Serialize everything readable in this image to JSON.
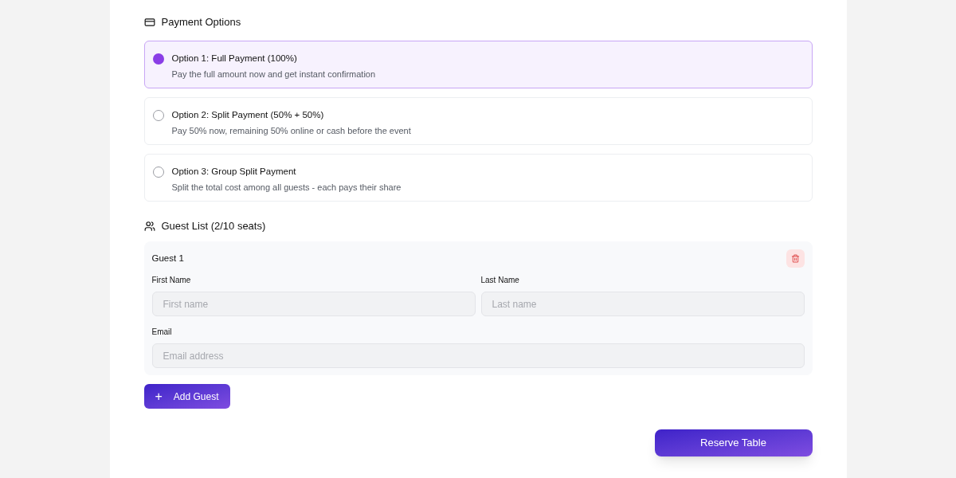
{
  "payment": {
    "title": "Payment Options",
    "options": [
      {
        "title": "Option 1: Full Payment (100%)",
        "description": "Pay the full amount now and get instant confirmation",
        "selected": true
      },
      {
        "title": "Option 2: Split Payment (50% + 50%)",
        "description": "Pay 50% now, remaining 50% online or cash before the event",
        "selected": false
      },
      {
        "title": "Option 3: Group Split Payment",
        "description": "Split the total cost among all guests - each pays their share",
        "selected": false
      }
    ]
  },
  "guests": {
    "title": "Guest List (2/10 seats)",
    "items": [
      {
        "title": "Guest 1",
        "first_name_label": "First Name",
        "first_name_placeholder": "First name",
        "last_name_label": "Last Name",
        "last_name_placeholder": "Last name",
        "email_label": "Email",
        "email_placeholder": "Email address"
      }
    ],
    "add_button": {
      "icon": "+",
      "label": "Add Guest"
    }
  },
  "submit_button": "Reserve Table"
}
